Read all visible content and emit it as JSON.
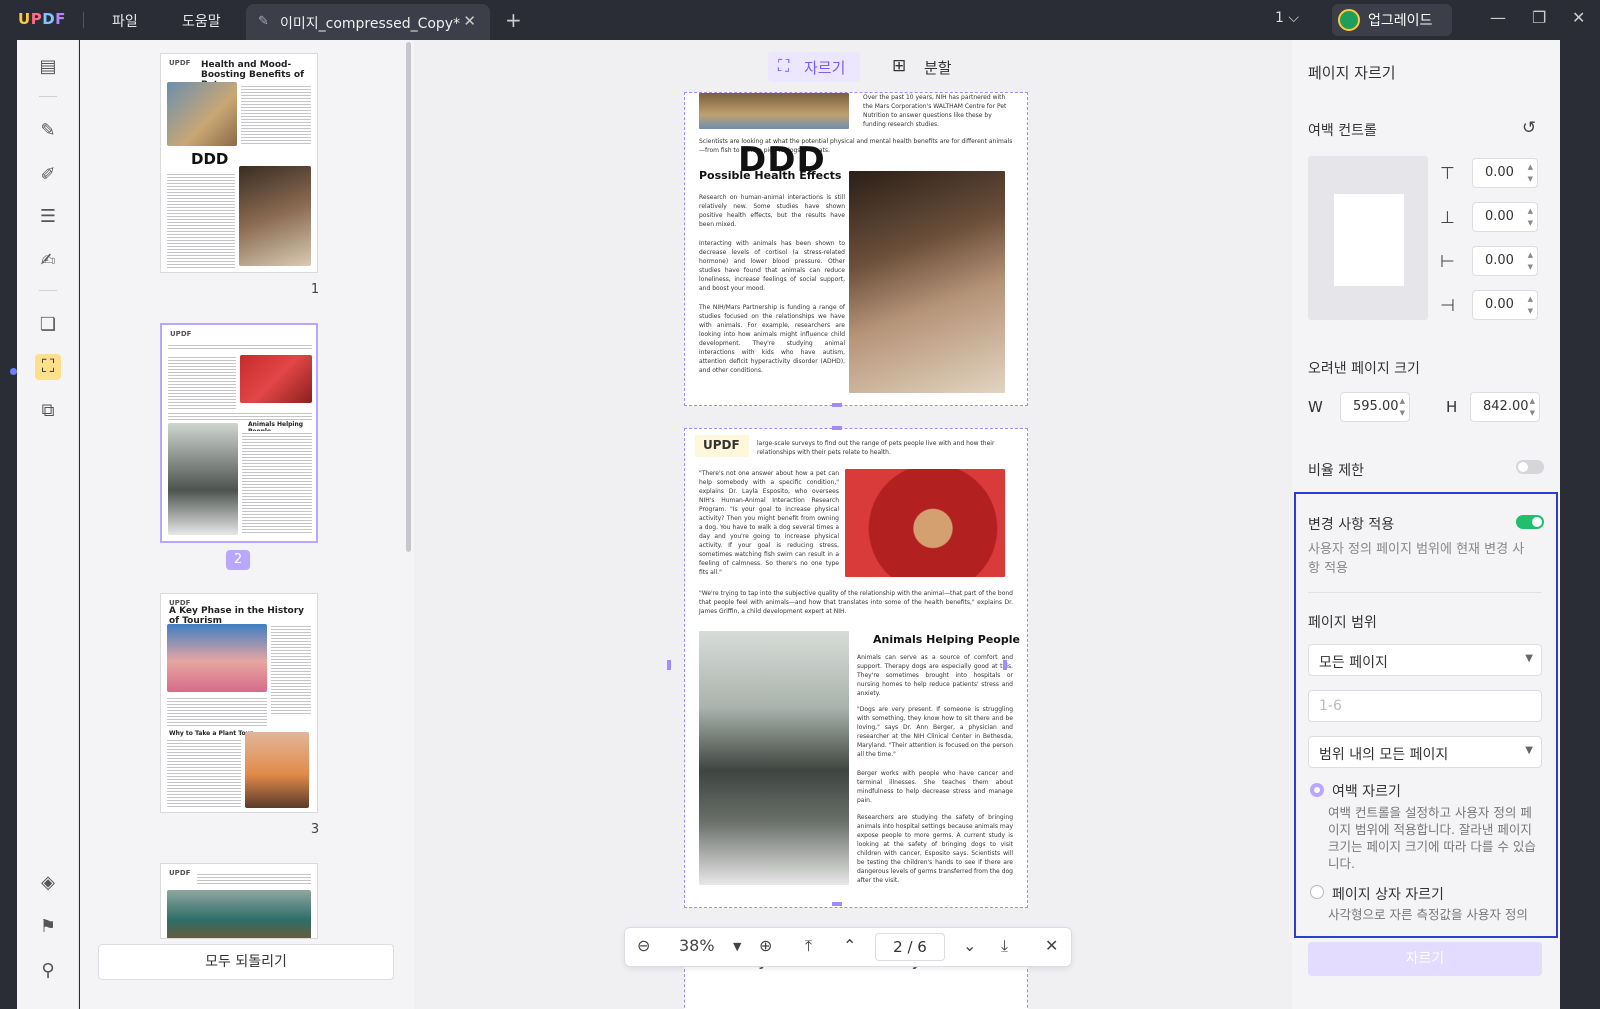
{
  "titlebar": {
    "menu_file": "파일",
    "menu_help": "도움말",
    "tab_title": "이미지_compressed_Copy*",
    "page_indicator": "1",
    "upgrade_label": "업그레이드"
  },
  "left_toolbar": {
    "items": [
      "reader-icon",
      "comment-icon",
      "edit-icon",
      "form-icon",
      "fill-sign-icon",
      "organize-icon",
      "crop-icon",
      "tools-icon"
    ],
    "bottom": [
      "layers-icon",
      "bookmark-icon",
      "attachment-icon"
    ]
  },
  "thumbnails": {
    "pages": [
      {
        "number": "1",
        "title": "Health and Mood-Boosting Benefits of Pets",
        "logo": "UPDF",
        "overlay": "DDD"
      },
      {
        "number": "2",
        "title": "Animals Helping People",
        "logo": "UPDF"
      },
      {
        "number": "3",
        "title": "A Key Phase in the History of Tourism",
        "subhead": "Why to Take a Plant Tour",
        "logo": "UPDF"
      },
      {
        "number": "",
        "title": "",
        "logo": "UPDF"
      }
    ],
    "selected_page": "2",
    "reset_all_label": "모두 되돌리기"
  },
  "main": {
    "crop_tab_label": "자르기",
    "split_tab_label": "분할",
    "overlay_text": "DDD",
    "page1": {
      "heading": "Possible Health Effects",
      "top_text": "Over the past 10 years, NIH has partnered with the Mars Corporation's WALTHAM Centre for Pet Nutrition to answer questions like these by funding research studies.",
      "lead": "Scientists are looking at what the potential physical and mental health benefits are for different animals—from fish to guinea pigs to dogs and cats.",
      "p1": "Research on human-animal interactions is still relatively new. Some studies have shown positive health effects, but the results have been mixed.",
      "p2": "Interacting with animals has been shown to decrease levels of cortisol (a stress-related hormone) and lower blood pressure. Other studies have found that animals can reduce loneliness, increase feelings of social support, and boost your mood.",
      "p3": "The NIH/Mars Partnership is funding a range of studies focused on the relationships we have with animals. For example, researchers are looking into how animals might influence child development. They're studying animal interactions with kids who have autism, attention deficit hyperactivity disorder (ADHD), and other conditions."
    },
    "page2": {
      "logo": "UPDF",
      "top_text": "large-scale surveys to find out the range of pets people live with and how their relationships with their pets relate to health.",
      "quote1": "\"There's not one answer about how a pet can help somebody with a specific condition,\" explains Dr. Layla Esposito, who oversees NIH's Human-Animal Interaction Research Program. \"Is your goal to increase physical activity? Then you might benefit from owning a dog. You have to walk a dog several times a day and you're going to increase physical activity. If your goal is reducing stress, sometimes watching fish swim can result in a feeling of calmness. So there's no one type fits all.\"",
      "quote2": "\"We're trying to tap into the subjective quality of the relationship with the animal—that part of the bond that people feel with animals—and how that translates into some of the health benefits,\" explains Dr. James Griffin, a child development expert at NIH.",
      "heading": "Animals Helping People",
      "p1": "Animals can serve as a source of comfort and support. Therapy dogs are especially good at this. They're sometimes brought into hospitals or nursing homes to help reduce patients' stress and anxiety.",
      "p2": "\"Dogs are very present. If someone is struggling with something, they know how to sit there and be loving,\" says Dr. Ann Berger, a physician and researcher at the NIH Clinical Center in Bethesda, Maryland. \"Their attention is focused on the person all the time.\"",
      "p3": "Berger works with people who have cancer and terminal illnesses. She teaches them about mindfulness to help decrease stress and manage pain.",
      "p4": "Researchers are studying the safety of bringing animals into hospital settings because animals may expose people to more germs. A current study is looking at the safety of bringing dogs to visit children with cancer, Esposito says. Scientists will be testing the children's hands to see if there are dangerous levels of germs transferred from the dog after the visit."
    },
    "page3_heading": "A Key Phase in the History of Tourism"
  },
  "zoombar": {
    "zoom": "38%",
    "current_page": "2",
    "total_pages": "6",
    "page_display": "2 / 6"
  },
  "right_panel": {
    "title": "페이지 자르기",
    "margin_control_label": "여백 컨트롤",
    "margins": {
      "top": "0.00",
      "bottom": "0.00",
      "left": "0.00",
      "right": "0.00"
    },
    "cropped_size_label": "오려낸 페이지 크기",
    "w_label": "W",
    "w_value": "595.00",
    "h_label": "H",
    "h_value": "842.00",
    "ratio_label": "비율 제한",
    "ratio_on": false,
    "apply_label": "변경 사항 적용",
    "apply_on": true,
    "apply_desc": "사용자 정의 페이지 범위에 현재 변경 사항 적용",
    "page_range_label": "페이지 범위",
    "page_range_select": "모든 페이지",
    "range_placeholder": "1-6",
    "range_subset_select": "범위 내의 모든 페이지",
    "option_margin_label": "여백 자르기",
    "option_margin_desc": "여백 컨트롤을 설정하고 사용자 정의 페이지 범위에 적용합니다. 잘라낸 페이지 크기는 페이지 크기에 따라 다를 수 있습니다.",
    "option_box_label": "페이지 상자 자르기",
    "option_box_desc": "사각형으로 자른 측정값을 사용자 정의",
    "crop_button_label": "자르기",
    "colors": {
      "accent": "#b9a6ff",
      "toggle_on": "#1fbf6c",
      "highlight": "#2f3cd1"
    }
  }
}
